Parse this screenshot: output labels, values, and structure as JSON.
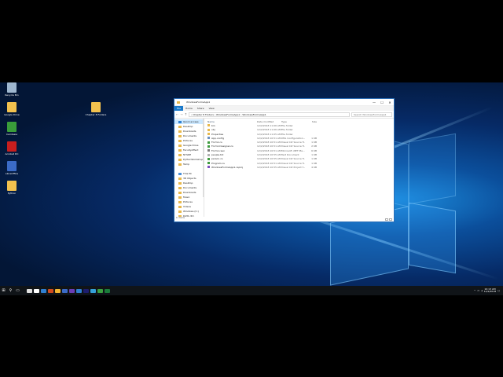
{
  "desktop": {
    "icons": [
      {
        "label": "Recycle Bin",
        "color": "#9fb7cf"
      },
      {
        "label": "Google Drive",
        "color": "#f2c14e"
      },
      {
        "label": "Camtasia",
        "color": "#3a9d3a"
      },
      {
        "label": "Acrobat DC",
        "color": "#c81e1e"
      },
      {
        "label": "LibreOffice",
        "color": "#3b6bc7"
      },
      {
        "label": "Python",
        "color": "#f2c14e"
      }
    ],
    "folder_icon": {
      "label": "Chapter 8 Folders",
      "color": "#f2c14e"
    }
  },
  "explorer": {
    "title": "WindowsFormsApp1",
    "controls": [
      "—",
      "☐",
      "✕"
    ],
    "ribbon_tabs": [
      "File",
      "Home",
      "Share",
      "View"
    ],
    "address": "› Chapter 8 Folders › WindowsFormsApp1 › WindowsFormsApp1",
    "search_placeholder": "Search WindowsFormsApp1",
    "nav_items": [
      {
        "label": "Quick access"
      },
      {
        "label": "Desktop"
      },
      {
        "label": "Downloads"
      },
      {
        "label": "Documents"
      },
      {
        "label": "Pictures"
      },
      {
        "label": "Google Drive"
      },
      {
        "label": "FacultyAffect"
      },
      {
        "label": "NYSDE"
      },
      {
        "label": "PythonWorkshop"
      },
      {
        "label": "Temp"
      },
      {
        "label": ""
      },
      {
        "label": "This PC"
      },
      {
        "label": "3D Objects"
      },
      {
        "label": "Desktop"
      },
      {
        "label": "Documents"
      },
      {
        "label": "Downloads"
      },
      {
        "label": "Music"
      },
      {
        "label": "Pictures"
      },
      {
        "label": "Videos"
      },
      {
        "label": "Windows (C:)"
      },
      {
        "label": "DATA (D:)"
      },
      {
        "label": "Clipboard 3 (CubeFS)"
      }
    ],
    "columns": {
      "name": "Name",
      "date": "Date modified",
      "type": "Type",
      "size": "Size"
    },
    "files": [
      {
        "name": "bin",
        "date": "12/2/2018 11:06 AM",
        "type": "File folder",
        "size": "",
        "icon_color": "#e8b84a"
      },
      {
        "name": "obj",
        "date": "12/2/2018 11:06 AM",
        "type": "File folder",
        "size": "",
        "icon_color": "#e8b84a"
      },
      {
        "name": "Properties",
        "date": "12/2/2018 11:05 AM",
        "type": "File folder",
        "size": "",
        "icon_color": "#e8b84a"
      },
      {
        "name": "App.config",
        "date": "12/2/2018 10:51 AM",
        "type": "XML Configuration...",
        "size": "1 KB",
        "icon_color": "#6a8fbf"
      },
      {
        "name": "Form1.cs",
        "date": "12/2/2018 10:51 AM",
        "type": "Visual C# Source fi...",
        "size": "1 KB",
        "icon_color": "#3e9b3e"
      },
      {
        "name": "Form1.Designer.cs",
        "date": "12/2/2018 10:51 AM",
        "type": "Visual C# Source fi...",
        "size": "2 KB",
        "icon_color": "#3e9b3e"
      },
      {
        "name": "Form1.resx",
        "date": "12/2/2018 10:51 AM",
        "type": "Microsoft .NET Ma...",
        "size": "6 KB",
        "icon_color": "#7a7a7a"
      },
      {
        "name": "people.txt",
        "date": "12/2/2018 10:55 AM",
        "type": "Text Document",
        "size": "1 KB",
        "icon_color": "#b0b0b0"
      },
      {
        "name": "person.cs",
        "date": "12/2/2018 10:55 AM",
        "type": "Visual C# Source fi...",
        "size": "1 KB",
        "icon_color": "#3e9b3e"
      },
      {
        "name": "Program.cs",
        "date": "12/2/2018 10:51 AM",
        "type": "Visual C# Source fi...",
        "size": "1 KB",
        "icon_color": "#3e9b3e"
      },
      {
        "name": "WindowsFormsApp1.csproj",
        "date": "12/2/2018 10:55 AM",
        "type": "Visual C# Project f...",
        "size": "4 KB",
        "icon_color": "#7c4dbf"
      }
    ],
    "status": "11 items"
  },
  "taskbar": {
    "start_icon": "windows-logo",
    "apps": [
      "#e0e0e0",
      "#ffffff",
      "#2f7fd0",
      "#d04a1e",
      "#f2b632",
      "#3b6bc7",
      "#6a3db5",
      "#2f7fd0",
      "#1d1d6e",
      "#35a0d8",
      "#3aa040",
      "#1a7c3a"
    ],
    "clock_time": "10:13 AM",
    "clock_date": "12/2/2018"
  }
}
